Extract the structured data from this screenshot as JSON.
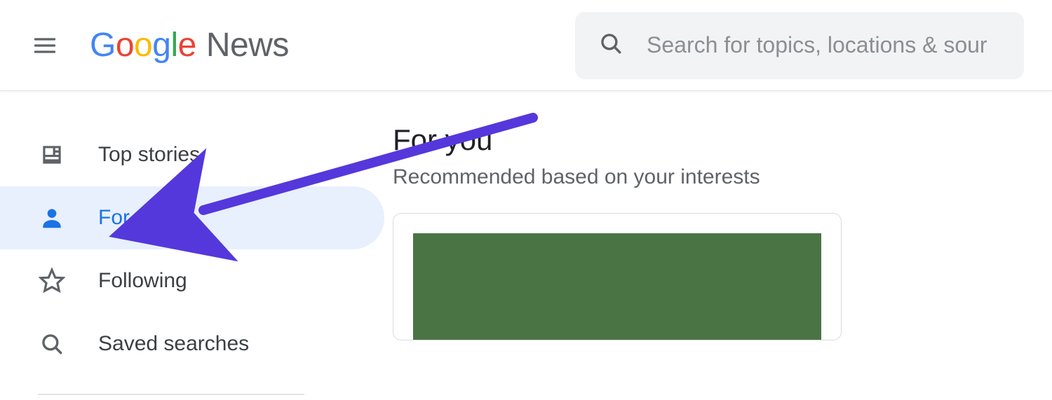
{
  "header": {
    "logo_text": "Google",
    "logo_product": "News",
    "search_placeholder": "Search for topics, locations & sour"
  },
  "sidebar": {
    "items": [
      {
        "label": "Top stories",
        "icon": "newspaper-icon",
        "active": false
      },
      {
        "label": "For you",
        "icon": "person-icon",
        "active": true
      },
      {
        "label": "Following",
        "icon": "star-icon",
        "active": false
      },
      {
        "label": "Saved searches",
        "icon": "search-icon",
        "active": false
      }
    ]
  },
  "main": {
    "title": "For you",
    "subtitle": "Recommended based on your interests"
  },
  "annotation": {
    "arrow_color": "#5438DC",
    "points_to": "sidebar-item-for-you"
  }
}
